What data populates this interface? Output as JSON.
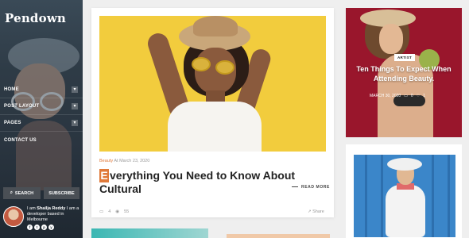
{
  "site": {
    "logo": "Pendown"
  },
  "nav": [
    {
      "label": "HOME",
      "has_submenu": true
    },
    {
      "label": "POST LAYOUT",
      "has_submenu": true
    },
    {
      "label": "PAGES",
      "has_submenu": true
    },
    {
      "label": "CONTACT US",
      "has_submenu": false
    }
  ],
  "sidebar_buttons": {
    "search": "SEARCH",
    "subscribe": "SUBSCRIBE"
  },
  "about": {
    "prefix": "I am ",
    "name": "Shailja Reddy",
    "suffix": " I am a developer based in Melbourne",
    "socials": [
      "f",
      "t",
      "p",
      "y"
    ]
  },
  "featured": {
    "category": "Beauty",
    "date": "At March 23, 2020",
    "dropcap": "E",
    "title_rest": "verything You Need to Know About Cultural",
    "read_more": "READ MORE",
    "comments": "4",
    "views": "55",
    "share": "Share"
  },
  "side_post": {
    "badge": "ARTIST",
    "title": "Ten Things To Expect When Attending Beauty.",
    "date": "MARCH 30, 2020",
    "comments": "0",
    "likes": "1"
  },
  "colors": {
    "accent": "#e07a3a",
    "side_bg": "#99162c",
    "hero_bg": "#f2cc3d"
  }
}
